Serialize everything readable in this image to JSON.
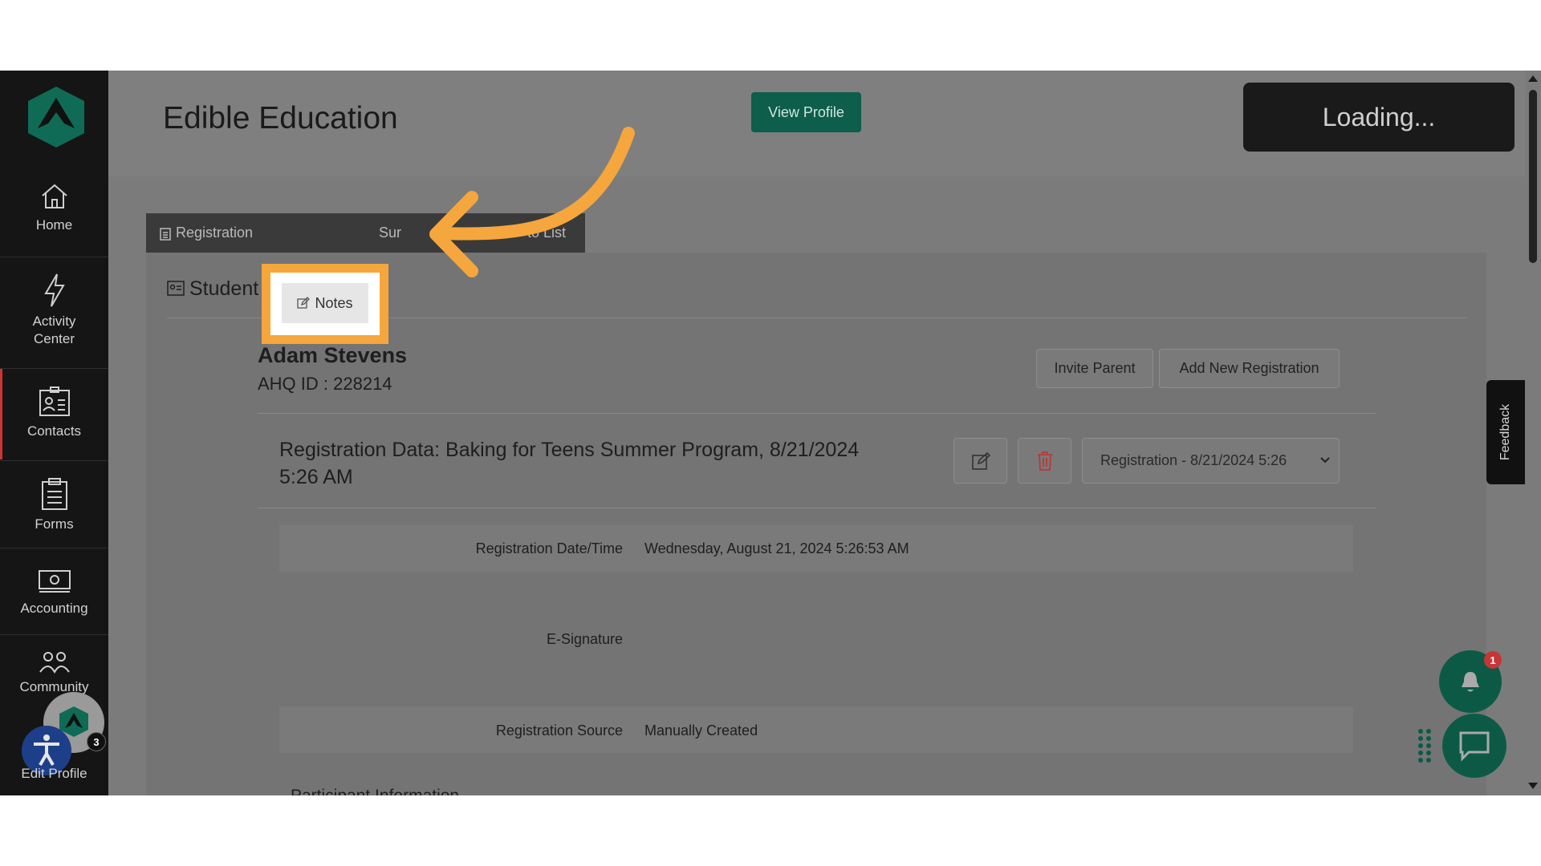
{
  "app": {
    "page_title": "Edible Education",
    "view_profile_label": "View Profile",
    "loading_label": "Loading..."
  },
  "sidebar": {
    "items": [
      {
        "label": "Home",
        "icon": "home-icon"
      },
      {
        "label": "Activity Center",
        "icon": "lightning-icon"
      },
      {
        "label": "Contacts",
        "icon": "contacts-icon"
      },
      {
        "label": "Forms",
        "icon": "clipboard-icon"
      },
      {
        "label": "Accounting",
        "icon": "money-icon"
      },
      {
        "label": "Community",
        "icon": "community-icon"
      },
      {
        "label": "Edit Profile",
        "icon": "avatar-icon"
      }
    ],
    "edit_profile_badge": "3"
  },
  "tabs": [
    {
      "label": "Registration",
      "icon": "clipboard-icon"
    },
    {
      "label": "Notes",
      "icon": "edit-icon"
    },
    {
      "label": "Sur",
      "icon": "link-icon"
    },
    {
      "label": "to List",
      "icon": ""
    }
  ],
  "card": {
    "section_title": "Student Detail",
    "student_name": "Adam Stevens",
    "ahq_id": "AHQ ID : 228214",
    "invite_parent_label": "Invite Parent",
    "add_registration_label": "Add New Registration",
    "registration_heading_line1": "Registration Data: Baking for Teens Summer Program, 8/21/2024",
    "registration_heading_line2": "5:26 AM",
    "registration_select_value": "Registration - 8/21/2024 5:26",
    "fields": [
      {
        "label": "Registration Date/Time",
        "value": "Wednesday, August 21, 2024 5:26:53 AM"
      },
      {
        "label": "E-Signature",
        "value": ""
      },
      {
        "label": "Registration Source",
        "value": "Manually Created"
      }
    ],
    "next_section_partial": "Participant Information"
  },
  "feedback_label": "Feedback",
  "notifications": {
    "count": "1"
  },
  "colors": {
    "brand_green": "#0d5e4a",
    "highlight_orange": "#f5a63c",
    "sidebar_bg": "#151515"
  }
}
